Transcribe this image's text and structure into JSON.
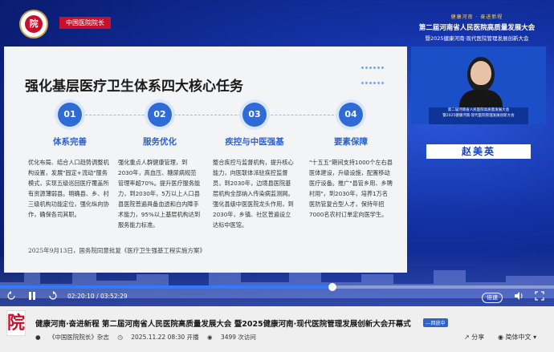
{
  "header": {
    "brand_text": "中国医院院长",
    "conference": {
      "tagline": "健康河南 · 奋进新程",
      "title": "第二届河南省人民医院高质量发展大会",
      "subtitle": "暨2025健康河南·现代医院管理发展创新大会"
    }
  },
  "slide": {
    "title": "强化基层医疗卫生体系四大核心任务",
    "tasks": [
      {
        "number": "01",
        "title": "体系完善",
        "body": "优化布局、结合人口趋势调整机构设置，发展\"固定+流动\"服务模式，实现五级巡回医疗覆盖所有资源薄弱县。明确县、乡、村三级机构功能定位，强化纵向协作，确保各司其职。"
      },
      {
        "number": "02",
        "title": "服务优化",
        "body": "强化重点人群健康管理，到2030年，高血压、糖尿病规范管理率超70%。提升医疗服务能力，到2030年，5万以上人口县县医院普遍具备血透和白内障手术能力，95%以上基层机构达到服务能力标准。"
      },
      {
        "number": "03",
        "title": "疾控与中医强基",
        "body": "整合疾控与监督机构，提升核心能力，向医联体派驻疾控监督员，到2030年，边境县医院基层机构全部纳入传染病监测网。强化县级中医医院龙头作用，到2030年，乡镇、社区普遍设立达标中医馆。"
      },
      {
        "number": "04",
        "title": "要素保障",
        "body": "\"十五五\"期间支持1000个左右县医体建设，升级设施，配置移动医疗设备。推广\"县管乡用、乡聘村用\"，到2030年，培养1万名医防管复合型人才，保持年招7000名农村订单定向医学生。"
      }
    ],
    "footnote": "2025年9月13日，国务院同意批复《医疗卫生强基工程实施方案》"
  },
  "video": {
    "podium_line1": "第二届河南省人民医院高质量发展大会",
    "podium_line2": "暨2025健康河南·现代医院管理发展创新大会"
  },
  "speaker_name": "赵美英",
  "player": {
    "current_time": "02:20:10",
    "duration": "03:52:29",
    "time_separator": "/",
    "progress_fraction": 0.6,
    "rate_label": "倍速",
    "language_label": "简体中文"
  },
  "info": {
    "avatar_char": "院",
    "title": "健康河南·奋进新程 第二届河南省人民医院高质量发展大会 暨2025健康河南·现代医院管理发展创新大会开幕式",
    "badge": "---回放中",
    "channel": "《中国医院院长》杂志",
    "date": "2025.11.22 08:30 开播",
    "views": "3499 次访问",
    "share": "分享"
  },
  "colors": {
    "accent": "#2f63c8",
    "brand_red": "#c8102e",
    "stage_blue": "#1433a8"
  }
}
